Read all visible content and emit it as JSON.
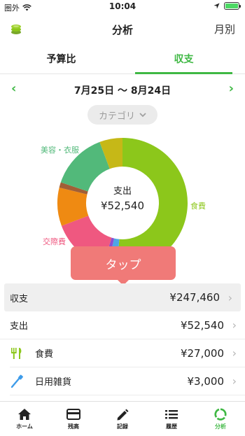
{
  "status_bar": {
    "carrier": "圏外",
    "time": "10:04"
  },
  "header": {
    "title": "分析",
    "monthly_label": "月別"
  },
  "tabs": [
    {
      "label": "予算比",
      "active": false
    },
    {
      "label": "収支",
      "active": true
    }
  ],
  "date_range": {
    "text": "7月25日 〜 8月24日",
    "prev_icon": "chevron-left-icon",
    "next_icon": "chevron-right-icon"
  },
  "filter": {
    "label": "カテゴリ"
  },
  "donut": {
    "center_label": "支出",
    "center_amount": "¥52,540",
    "segment_labels": {
      "food": "食費",
      "social": "交際費",
      "beauty": "美容・衣服"
    }
  },
  "chart_data": {
    "type": "pie",
    "values": [
      {
        "label": "食費",
        "value": 27000,
        "color": "#8cc71b"
      },
      {
        "value": 1200,
        "color": "#4da6e6"
      },
      {
        "value": 600,
        "color": "#8a4fd1"
      },
      {
        "label": "交際費",
        "value": 7600,
        "color": "#ef5880"
      },
      {
        "value": 5000,
        "color": "#ef8a12"
      },
      {
        "value": 700,
        "color": "#a15f36"
      },
      {
        "label": "美容・衣服",
        "value": 7440,
        "color": "#52b97a"
      },
      {
        "value": 3000,
        "color": "#c6b817"
      }
    ]
  },
  "tooltip": {
    "text": "タップ"
  },
  "list": {
    "rows": [
      {
        "label": "収支",
        "amount": "¥247,460"
      },
      {
        "label": "支出",
        "amount": "¥52,540"
      },
      {
        "label": "食費",
        "amount": "¥27,000",
        "icon": "fork-knife-icon",
        "icon_color": "#8cc71b"
      },
      {
        "label": "日用雑貨",
        "amount": "¥3,000",
        "icon": "toothbrush-icon",
        "icon_color": "#3d9be9"
      }
    ]
  },
  "tabbar": [
    {
      "label": "ホーム",
      "icon": "home-icon",
      "active": false
    },
    {
      "label": "残高",
      "icon": "card-icon",
      "active": false
    },
    {
      "label": "記録",
      "icon": "pencil-icon",
      "active": false
    },
    {
      "label": "履歴",
      "icon": "list-icon",
      "active": false
    },
    {
      "label": "分析",
      "icon": "ring-chart-icon",
      "active": true
    }
  ],
  "colors": {
    "accent": "#3fb844",
    "tooltip": "#f07a78"
  }
}
